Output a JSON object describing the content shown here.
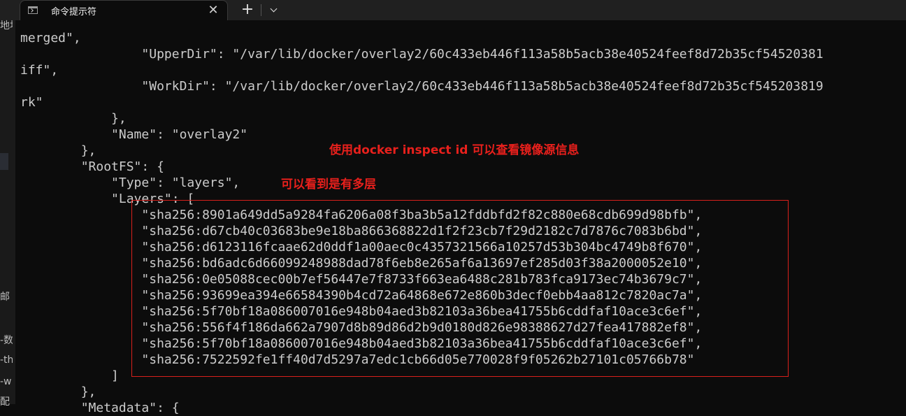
{
  "tab": {
    "title": "命令提示符",
    "close_glyph": "✕",
    "new_glyph": "+"
  },
  "left_edge": [
    "地址",
    "邮",
    "-数",
    "-th",
    "-w",
    "配"
  ],
  "terminal_lines": [
    "merged\",",
    "                \"UpperDir\": \"/var/lib/docker/overlay2/60c433eb446f113a58b5acb38e40524feef8d72b35cf54520381",
    "iff\",",
    "                \"WorkDir\": \"/var/lib/docker/overlay2/60c433eb446f113a58b5acb38e40524feef8d72b35cf545203819",
    "rk\"",
    "            },",
    "            \"Name\": \"overlay2\"",
    "        },",
    "        \"RootFS\": {",
    "            \"Type\": \"layers\",",
    "            \"Layers\": [",
    "                \"sha256:8901a649dd5a9284fa6206a08f3ba3b5a12fddbfd2f82c880e68cdb699d98bfb\",",
    "                \"sha256:d67cb40c03683be9e18ba866368822d1f2f23cb7f29d2182c7d7876c7083b6bd\",",
    "                \"sha256:d6123116fcaae62d0ddf1a00aec0c4357321566a10257d53b304bc4749b8f670\",",
    "                \"sha256:bd6adc6d66099248988dad78f6eb8e265af6a13697ef285d03f38a2000052e10\",",
    "                \"sha256:0e05088cec00b7ef56447e7f8733f663ea6488c281b783fca9173ec74b3679c7\",",
    "                \"sha256:93699ea394e66584390b4cd72a64868e672e860b3decf0ebb4aa812c7820ac7a\",",
    "                \"sha256:5f70bf18a086007016e948b04aed3b82103a36bea41755b6cddfaf10ace3c6ef\",",
    "                \"sha256:556f4f186da662a7907d8b89d86d2b9d0180d826e98388627d27fea417882ef8\",",
    "                \"sha256:5f70bf18a086007016e948b04aed3b82103a36bea41755b6cddfaf10ace3c6ef\",",
    "                \"sha256:7522592fe1ff40d7d5297a7edc1cb66d05e770028f9f05262b27101c05766b78\"",
    "            ]",
    "        },",
    "        \"Metadata\": {"
  ],
  "annotations": {
    "inspect_note": "使用docker inspect id 可以查看镜像源信息",
    "layers_note": "可以看到是有多层"
  },
  "colors": {
    "annotation": "#e8201c",
    "terminal_bg": "#0c0c0c",
    "terminal_text": "#cccccc"
  }
}
